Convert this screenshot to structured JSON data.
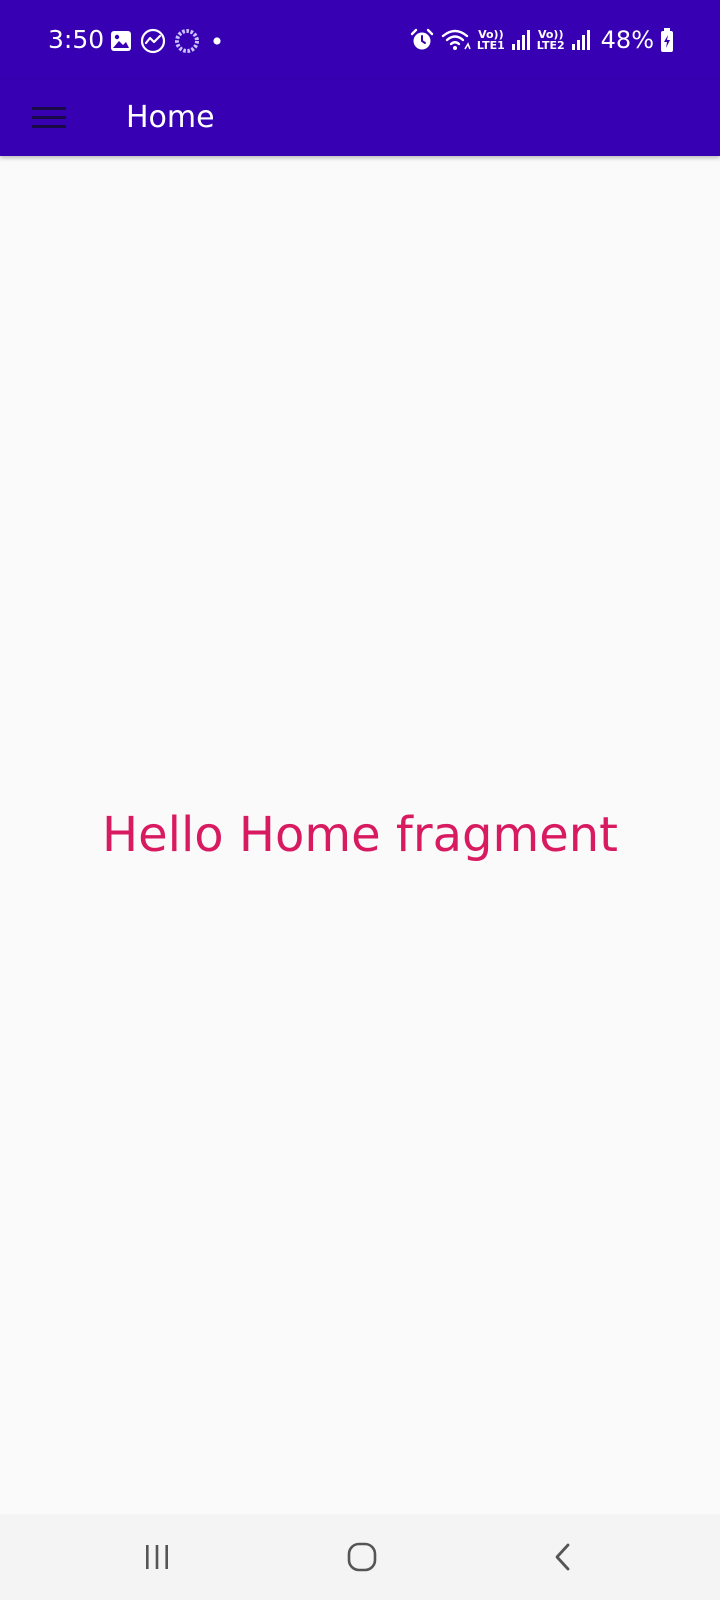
{
  "status_bar": {
    "time": "3:50",
    "left_icons": [
      "gallery-icon",
      "sync-icon",
      "loading-ring-icon",
      "notification-dot-icon"
    ],
    "right_icons": [
      "alarm-icon",
      "wifi-icon",
      "signal-icon",
      "signal-icon",
      "battery-charging-icon"
    ],
    "sim1": {
      "volte": "Vo))",
      "lte": "LTE1"
    },
    "sim2": {
      "volte": "Vo))",
      "lte": "LTE2"
    },
    "battery": "48%"
  },
  "toolbar": {
    "menu_icon": "menu-icon",
    "title": "Home",
    "background": "#3700b3"
  },
  "content": {
    "message": "Hello Home fragment",
    "message_color": "#d81b60",
    "background": "#fafafa"
  },
  "nav_bar": {
    "buttons": [
      "recent-apps-icon",
      "home-icon",
      "back-icon"
    ],
    "background": "#f4f4f4"
  }
}
